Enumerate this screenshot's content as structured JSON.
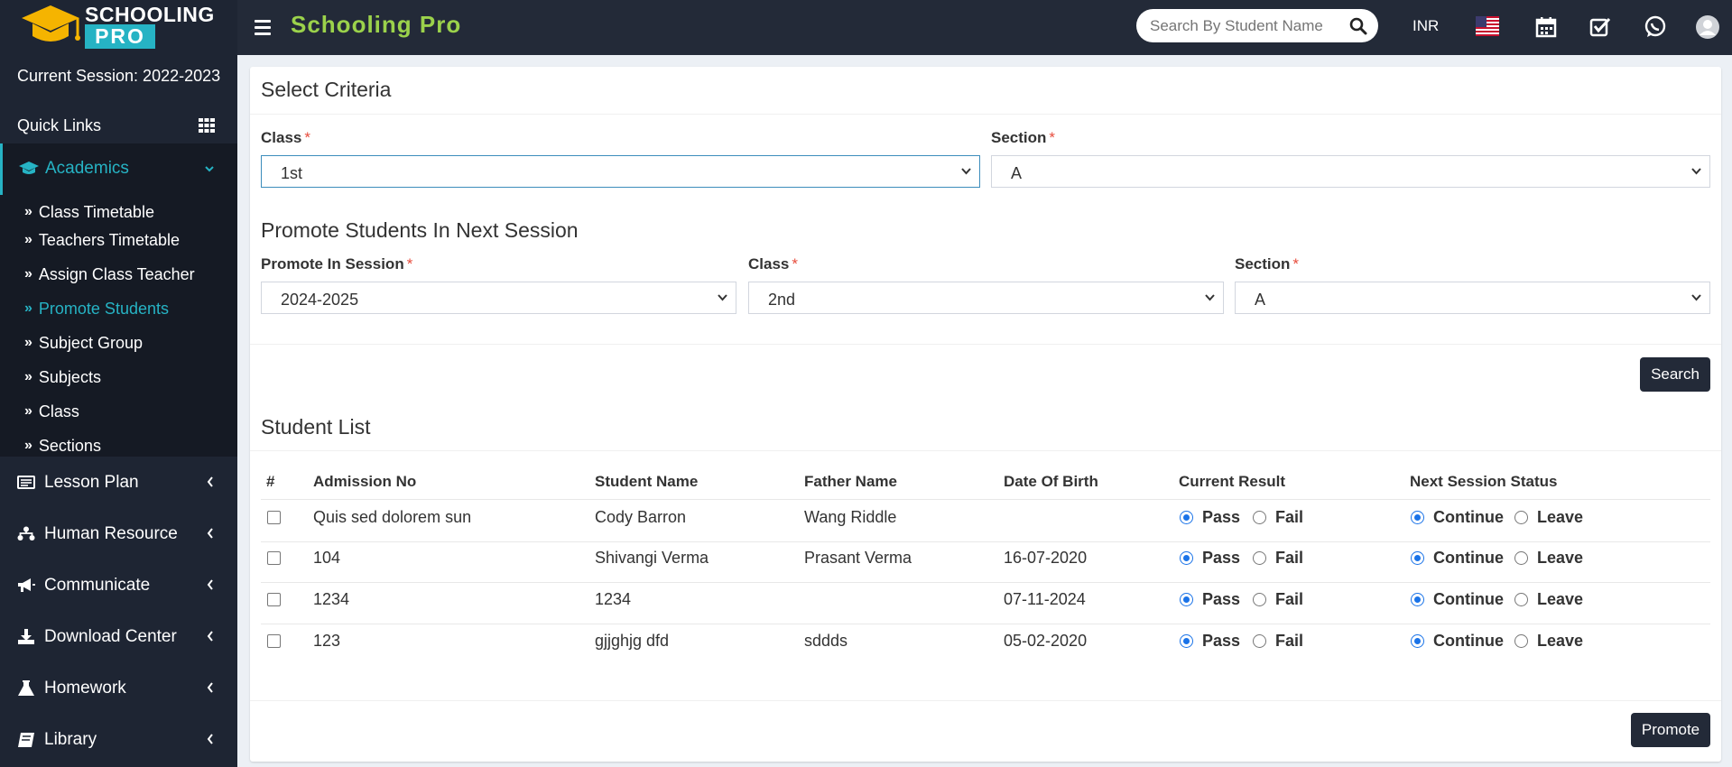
{
  "brand": {
    "logo_line1": "SCHOOLING",
    "logo_line2": "PRO",
    "app_title": "Schooling Pro"
  },
  "header": {
    "search_placeholder": "Search By Student Name",
    "currency": "INR",
    "icons": [
      "us-flag-icon",
      "calendar-icon",
      "checkbox-icon",
      "whatsapp-icon",
      "user-avatar-icon"
    ]
  },
  "sidebar": {
    "session": "Current Session: 2022-2023",
    "quick_links": "Quick Links",
    "academics": "Academics",
    "academics_items": [
      {
        "label": "Class Timetable"
      },
      {
        "label": "Teachers Timetable"
      },
      {
        "label": "Assign Class Teacher"
      },
      {
        "label": "Promote Students"
      },
      {
        "label": "Subject Group"
      },
      {
        "label": "Subjects"
      },
      {
        "label": "Class"
      },
      {
        "label": "Sections"
      }
    ],
    "active_item": "Promote Students",
    "menu": [
      {
        "label": "Lesson Plan",
        "icon": "lesson-plan-icon"
      },
      {
        "label": "Human Resource",
        "icon": "human-resource-icon"
      },
      {
        "label": "Communicate",
        "icon": "megaphone-icon"
      },
      {
        "label": "Download Center",
        "icon": "download-icon"
      },
      {
        "label": "Homework",
        "icon": "flask-icon"
      },
      {
        "label": "Library",
        "icon": "book-icon"
      }
    ]
  },
  "criteria": {
    "title": "Select Criteria",
    "class_label": "Class",
    "class_value": "1st",
    "section_label": "Section",
    "section_value": "A"
  },
  "promote": {
    "title": "Promote Students In Next Session",
    "session_label": "Promote In Session",
    "session_value": "2024-2025",
    "class_label": "Class",
    "class_value": "2nd",
    "section_label": "Section",
    "section_value": "A",
    "search_button": "Search"
  },
  "student_list": {
    "title": "Student List",
    "columns": [
      "#",
      "Admission No",
      "Student Name",
      "Father Name",
      "Date Of Birth",
      "Current Result",
      "Next Session Status"
    ],
    "rows": [
      {
        "admission": "Quis sed dolorem sun",
        "name": "Cody Barron",
        "father": "Wang Riddle",
        "dob": "",
        "result": "Pass",
        "status": "Continue"
      },
      {
        "admission": "104",
        "name": "Shivangi Verma",
        "father": "Prasant Verma",
        "dob": "16-07-2020",
        "result": "Pass",
        "status": "Continue"
      },
      {
        "admission": "1234",
        "name": "1234",
        "father": "",
        "dob": "07-11-2024",
        "result": "Pass",
        "status": "Continue"
      },
      {
        "admission": "123",
        "name": "gjjghjg dfd",
        "father": "sddds",
        "dob": "05-02-2020",
        "result": "Pass",
        "status": "Continue"
      }
    ],
    "pass_label": "Pass",
    "fail_label": "Fail",
    "continue_label": "Continue",
    "leave_label": "Leave",
    "promote_button": "Promote"
  },
  "colors": {
    "accent": "#26b3c4",
    "title_green": "#9bd24b",
    "sidebar_bg": "#1e2533",
    "button_bg": "#232a38",
    "required": "#e74c3c"
  }
}
